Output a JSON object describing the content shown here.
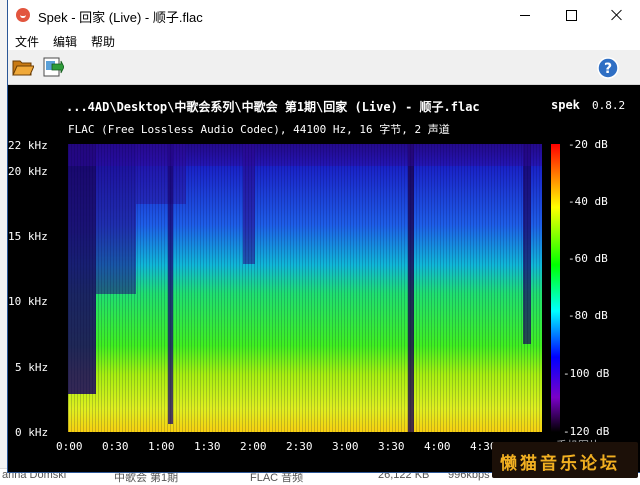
{
  "window": {
    "title": "Spek - 回家 (Live) - 顺子.flac"
  },
  "menu": {
    "file": "文件",
    "edit": "编辑",
    "help": "帮助"
  },
  "toolbar": {
    "open_icon": "folder-open-icon",
    "save_icon": "save-image-icon",
    "help_icon": "help-icon"
  },
  "plot": {
    "title": "...4AD\\Desktop\\中歌会系列\\中歌会 第1期\\回家 (Live) - 顺子.flac",
    "app_name": "spek",
    "version": "0.8.2",
    "subtitle": "FLAC (Free Lossless Audio Codec), 44100 Hz, 16 字节, 2 声道",
    "freq_ticks": [
      "22 kHz",
      "20 kHz",
      "15 kHz",
      "10 kHz",
      "5 kHz",
      "0 kHz"
    ],
    "time_ticks": [
      "0:00",
      "0:30",
      "1:00",
      "1:30",
      "2:00",
      "2:30",
      "3:00",
      "3:30",
      "4:00",
      "4:30"
    ],
    "db_ticks": [
      "-20 dB",
      "-40 dB",
      "-60 dB",
      "-80 dB",
      "-100 dB",
      "-120 dB"
    ],
    "colorbar_label": "手机图片"
  },
  "background": {
    "row_cells": [
      "arina Domski",
      "中歌会 第1期",
      "FLAC 音频",
      "26,122 KB",
      "996kbps"
    ]
  },
  "watermark": "懒猫音乐论坛",
  "colors": {
    "plot_bg": "#000000",
    "accent": "#2b5797"
  }
}
